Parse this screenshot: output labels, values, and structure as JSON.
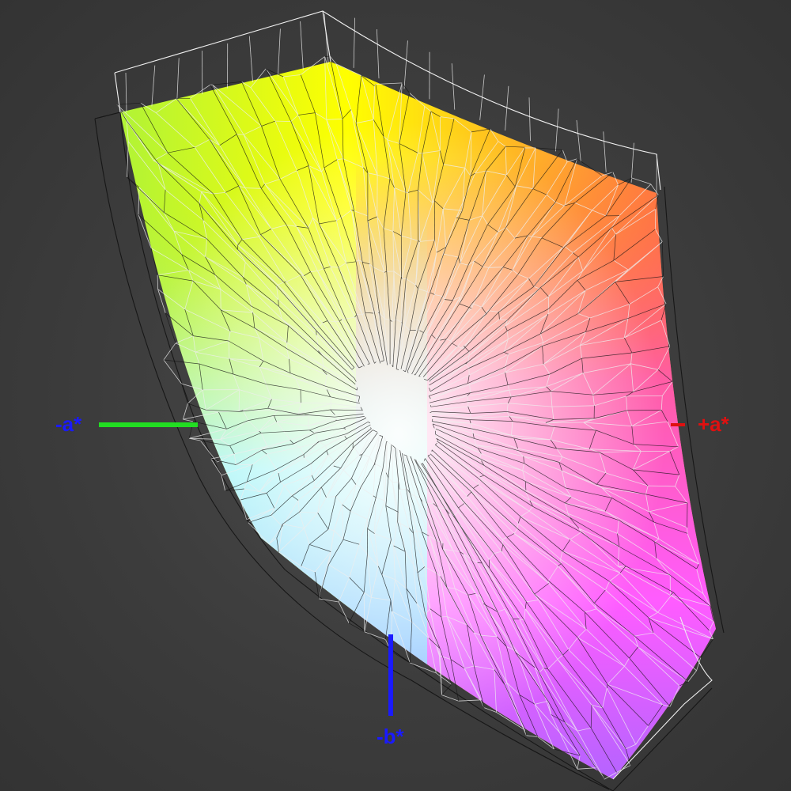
{
  "axes": {
    "neg_a": {
      "label": "-a*",
      "color": "#1a1aff",
      "line_color": "#22dd22"
    },
    "pos_a": {
      "label": "+a*",
      "color": "#e01010",
      "line_color": "#e01010"
    },
    "neg_b": {
      "label": "-b*",
      "color": "#1a1aff",
      "line_color": "#1a1aff"
    }
  },
  "colors": {
    "background": "#3c3c3c",
    "wire_light": "#e6e6e6",
    "wire_dark": "#111111",
    "gamut_gradient": [
      "#a8f23c",
      "#ffff00",
      "#ff8c2a",
      "#ff4fa0",
      "#ff4dff",
      "#b266ff",
      "#7aa6ff",
      "#a6f4ff",
      "#ffffff"
    ]
  }
}
